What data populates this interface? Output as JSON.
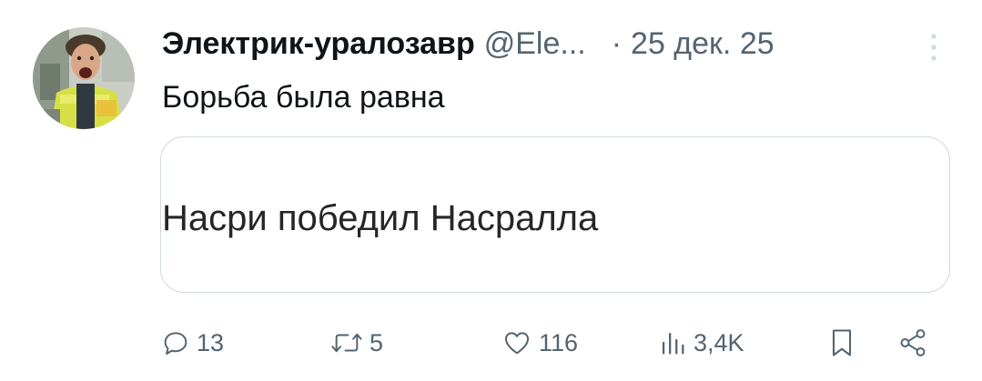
{
  "tweet": {
    "display_name": "Электрик-уралозавр",
    "handle": "@Ele...",
    "separator": "·",
    "date": "25 дек. 25",
    "text": "Борьба была равна",
    "card_text": "Насри победил Насралла"
  },
  "actions": {
    "replies": "13",
    "retweets": "5",
    "likes": "116",
    "views": "3,4K"
  },
  "icons": {
    "reply": "reply-icon",
    "retweet": "retweet-icon",
    "like": "heart-icon",
    "views": "views-icon",
    "bookmark": "bookmark-icon",
    "share": "share-icon",
    "more": "more-icon"
  },
  "colors": {
    "text": "#0f1419",
    "secondary": "#536471",
    "border": "#cfd9de"
  }
}
